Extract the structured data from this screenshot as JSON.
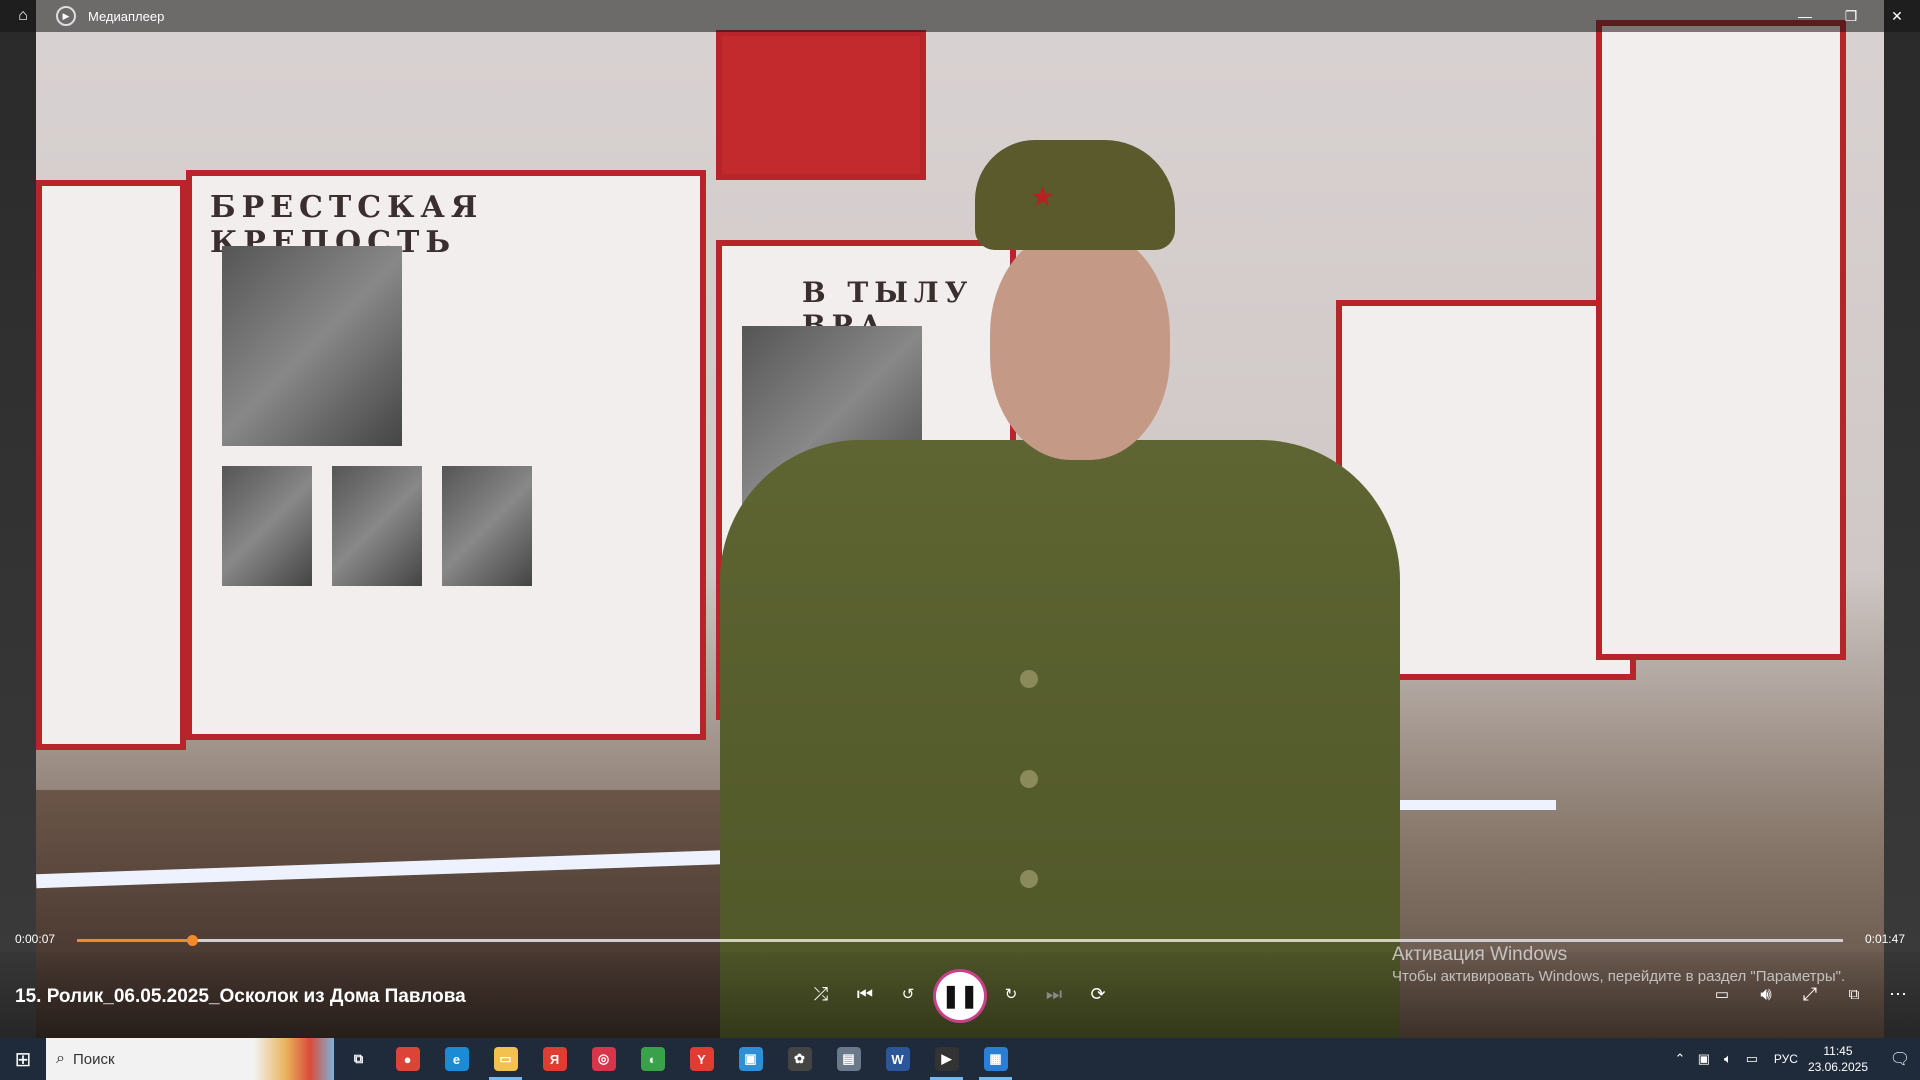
{
  "window": {
    "app_title": "Медиаплеер",
    "minimize_glyph": "—",
    "restore_glyph": "❐",
    "close_glyph": "✕"
  },
  "video": {
    "panel_title_1": "БРЕСТСКАЯ   КРЕПОСТЬ",
    "panel_title_2": "В ТЫЛУ ВРА"
  },
  "player": {
    "time_current": "0:00:07",
    "time_total": "0:01:47",
    "progress_fraction": 0.065,
    "now_playing": "15. Ролик_06.05.2025_Осколок из Дома Павлова",
    "accent_color": "#f28a2c"
  },
  "watermark": {
    "title": "Активация Windows",
    "text": "Чтобы активировать Windows, перейдите в раздел \"Параметры\"."
  },
  "taskbar": {
    "search_placeholder": "Поиск",
    "language": "РУС",
    "time": "11:45",
    "date": "23.06.2025",
    "apps": [
      {
        "name": "task-view",
        "glyph": "⧉",
        "color": "#1f2b3a"
      },
      {
        "name": "chrome",
        "glyph": "●",
        "color": "#db4437"
      },
      {
        "name": "edge",
        "glyph": "e",
        "color": "#1b8bd6"
      },
      {
        "name": "file-explorer",
        "glyph": "▭",
        "color": "#f2c14e"
      },
      {
        "name": "yandex",
        "glyph": "Я",
        "color": "#e03c31"
      },
      {
        "name": "app-6",
        "glyph": "◎",
        "color": "#d8344a"
      },
      {
        "name": "app-7",
        "glyph": "◐",
        "color": "#3aa14b"
      },
      {
        "name": "yandex-browser",
        "glyph": "Y",
        "color": "#e03c31"
      },
      {
        "name": "app-9",
        "glyph": "▣",
        "color": "#2d8fd5"
      },
      {
        "name": "app-10",
        "glyph": "✿",
        "color": "#444"
      },
      {
        "name": "app-11",
        "glyph": "▤",
        "color": "#6a7a8a"
      },
      {
        "name": "word",
        "glyph": "W",
        "color": "#2b579a"
      },
      {
        "name": "media-player",
        "glyph": "▶",
        "color": "#333"
      },
      {
        "name": "app-14",
        "glyph": "▦",
        "color": "#2a7fd4"
      }
    ]
  }
}
